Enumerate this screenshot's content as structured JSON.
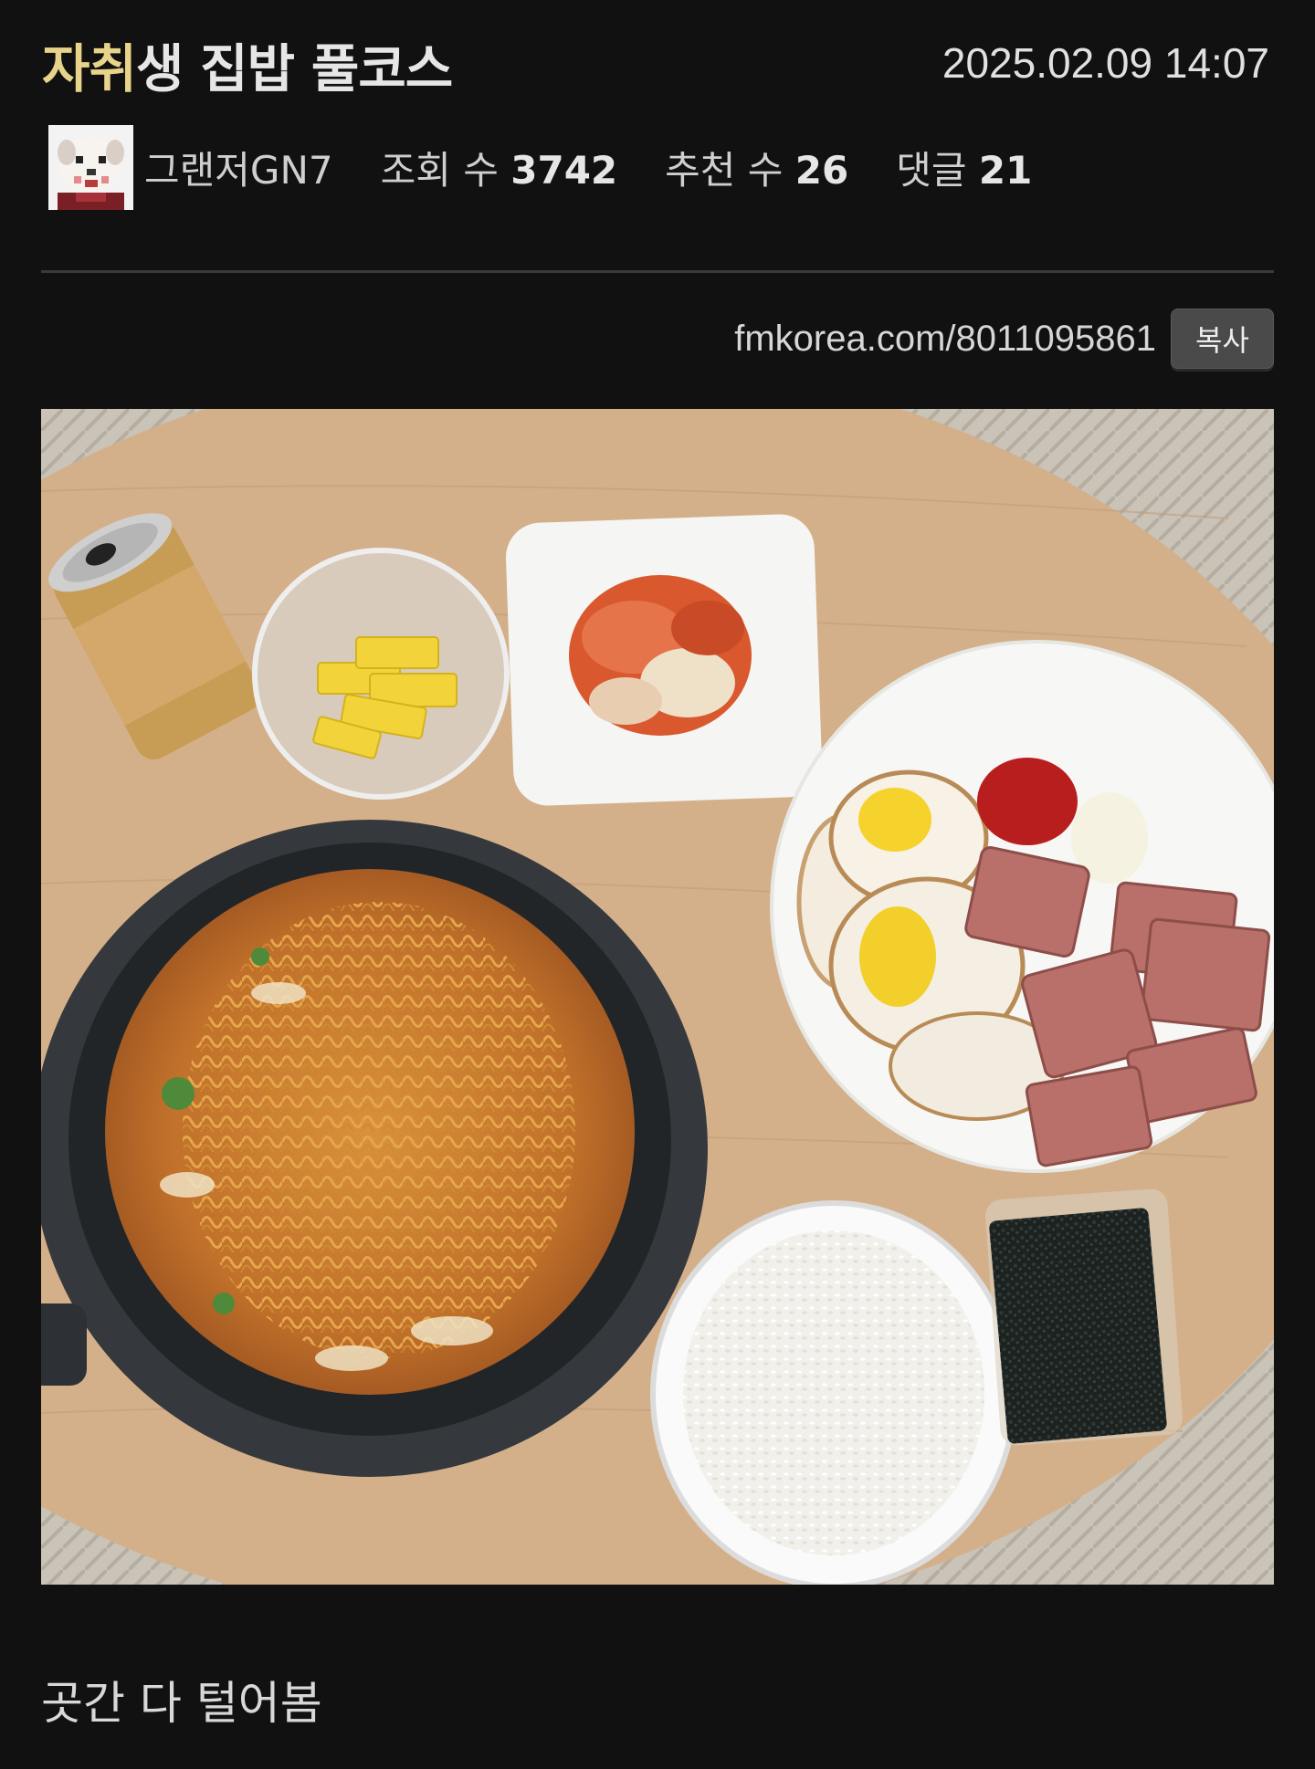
{
  "post": {
    "title_highlight": "자취",
    "title_rest": "생 집밥 풀코스",
    "date": "2025.02.09 14:07",
    "author": "그랜저GN7",
    "views_label": "조회 수",
    "views": "3742",
    "likes_label": "추천 수",
    "likes": "26",
    "comments_label": "댓글",
    "comments": "21",
    "url": "fmkorea.com/8011095861",
    "copy_label": "복사",
    "body": "곳간 다 털어봄"
  },
  "colors": {
    "background": "#111111",
    "title_highlight": "#e8d38a",
    "copy_button": "#4a4a4a"
  }
}
